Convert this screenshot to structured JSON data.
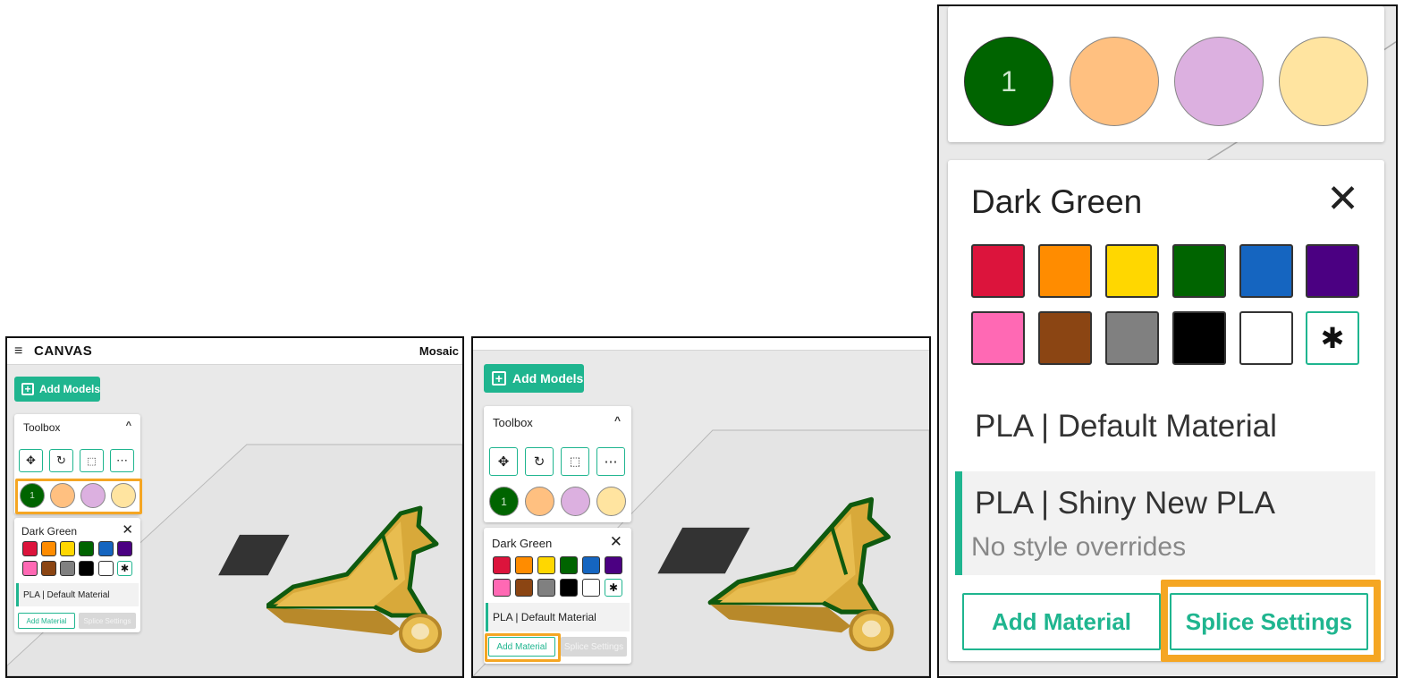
{
  "colors": {
    "accent": "#1fb58f",
    "highlight": "#f5a623",
    "palette": [
      "#dc143c",
      "#ff8c00",
      "#ffd700",
      "#006400",
      "#1565c0",
      "#4b0082",
      "#ff69b4",
      "#8b4513",
      "#808080",
      "#000000",
      "#ffffff"
    ],
    "circles": [
      "#006400",
      "#ffc080",
      "#dcb0e0",
      "#ffe4a0"
    ]
  },
  "panel1": {
    "menu_icon": "≡",
    "app_title": "CANVAS",
    "right_title": "Mosaic",
    "add_models": "Add Models",
    "toolbox_title": "Toolbox",
    "circle_label": "1",
    "color_title": "Dark Green",
    "material": "PLA | Default Material",
    "add_material": "Add Material",
    "splice_settings": "Splice Settings"
  },
  "panel2": {
    "add_models": "Add Models",
    "toolbox_title": "Toolbox",
    "circle_label": "1",
    "color_title": "Dark Green",
    "material": "PLA | Default Material",
    "add_material": "Add Material",
    "splice_settings": "Splice Settings"
  },
  "panel3": {
    "circle_label": "1",
    "color_title": "Dark Green",
    "material_default": "PLA | Default Material",
    "material_selected": "PLA | Shiny New PLA",
    "material_selected_sub": "No style overrides",
    "add_material": "Add Material",
    "splice_settings": "Splice Settings"
  },
  "icons": {
    "move": "move-icon",
    "rotate": "rotate-icon",
    "scale": "scale-icon",
    "more": "more-icon",
    "chevron": "chevron-up-icon",
    "close": "close-icon",
    "gear": "gear-icon"
  }
}
